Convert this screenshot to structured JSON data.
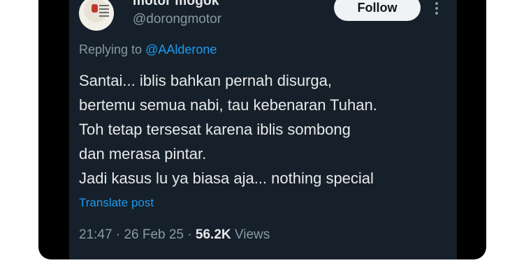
{
  "tweet": {
    "display_name": "motor mogok",
    "handle": "@dorongmotor",
    "follow_label": "Follow",
    "replying_prefix": "Replying to",
    "replying_to": "@AAlderone",
    "text_lines": [
      "Santai... iblis bahkan pernah disurga,",
      "bertemu semua nabi, tau kebenaran Tuhan.",
      "Toh tetap tersesat karena iblis sombong",
      "dan merasa pintar.",
      "Jadi kasus lu ya biasa aja... nothing special"
    ],
    "translate_label": "Translate post",
    "time": "21:47",
    "date": "26 Feb 25",
    "views_count": "56.2K",
    "views_label": "Views",
    "separator": "·"
  },
  "icons": {
    "avatar": "profile-avatar",
    "more": "more-vertical-icon"
  },
  "colors": {
    "background": "#15202b",
    "text": "#e7e9ea",
    "muted": "#8b98a5",
    "accent": "#1d9bf0",
    "follow_bg": "#eff3f4"
  }
}
